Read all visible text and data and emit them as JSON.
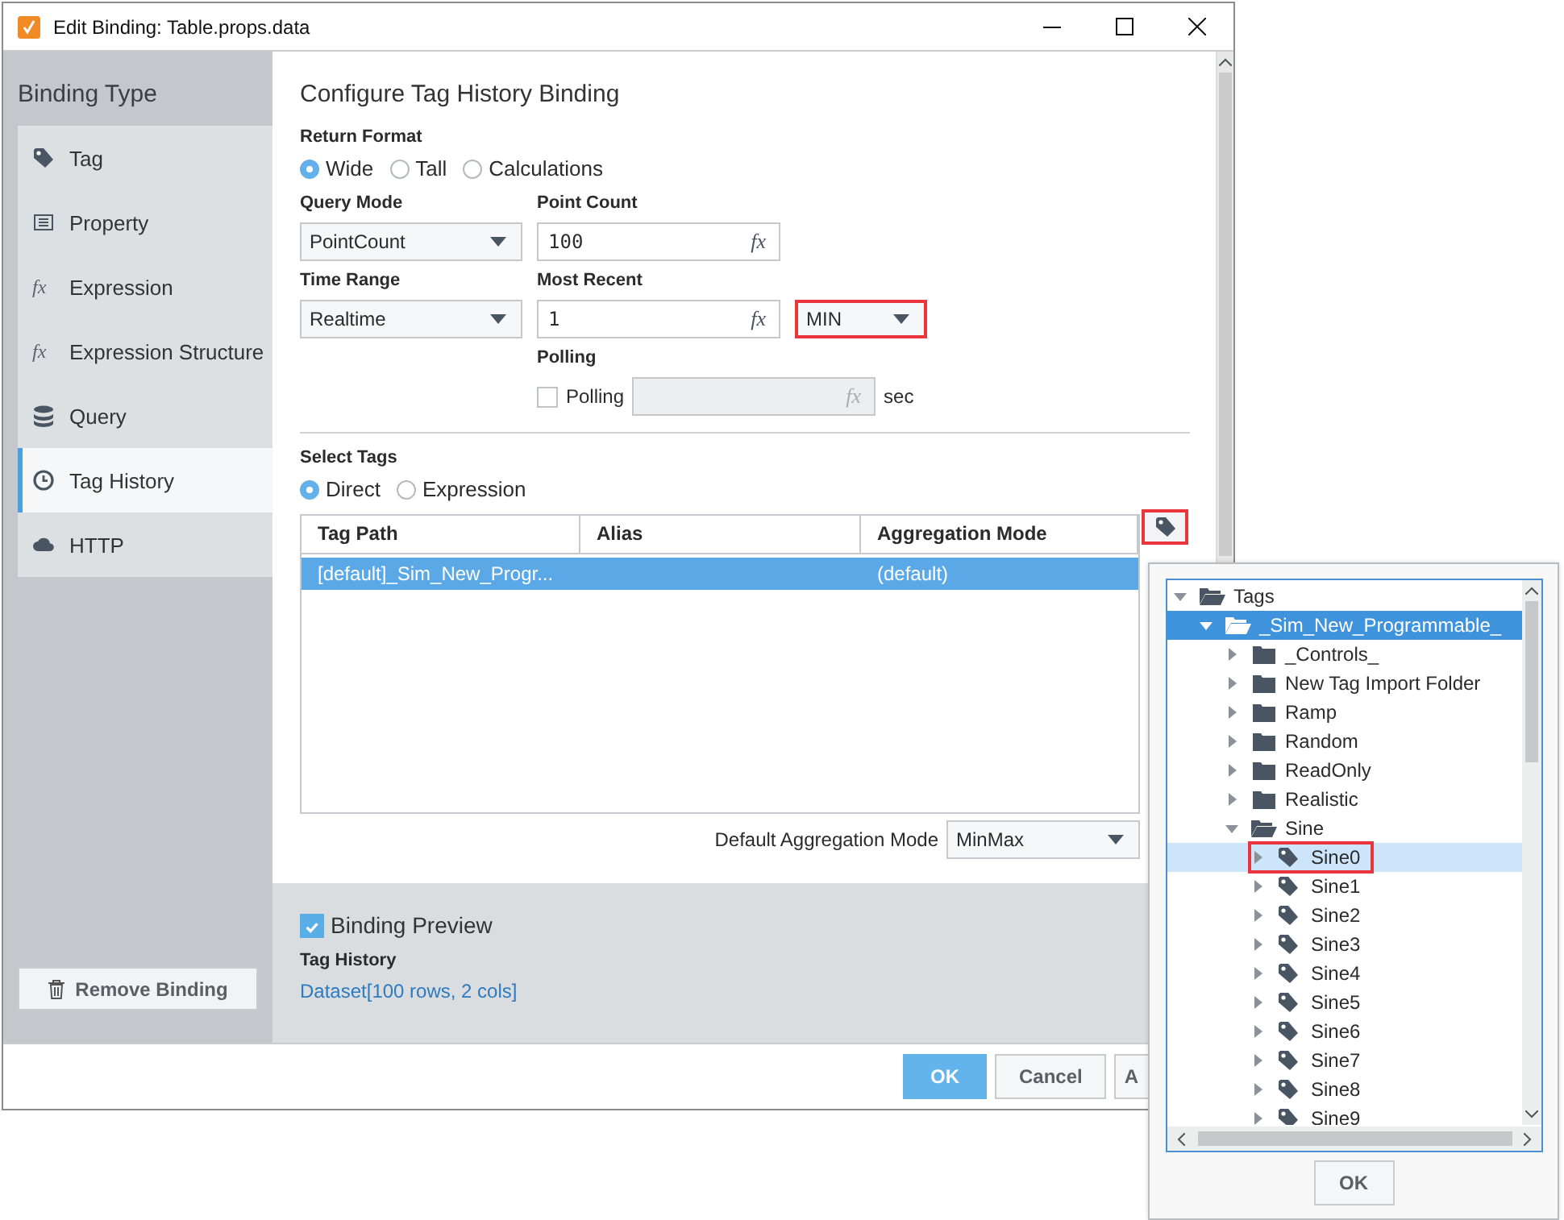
{
  "window": {
    "title": "Edit Binding: Table.props.data"
  },
  "sidebar": {
    "heading": "Binding Type",
    "items": [
      {
        "label": "Tag",
        "kind": "tag",
        "selected": false
      },
      {
        "label": "Property",
        "kind": "property",
        "selected": false
      },
      {
        "label": "Expression",
        "kind": "expression",
        "icon_text": "fx",
        "selected": false
      },
      {
        "label": "Expression Structure",
        "kind": "expression",
        "icon_text": "fx",
        "selected": false
      },
      {
        "label": "Query",
        "kind": "query",
        "selected": false
      },
      {
        "label": "Tag History",
        "kind": "history",
        "selected": true
      },
      {
        "label": "HTTP",
        "kind": "http",
        "selected": false
      }
    ],
    "remove_button": "Remove Binding"
  },
  "config": {
    "title": "Configure Tag History Binding",
    "return_format": {
      "label": "Return Format",
      "options": [
        {
          "label": "Wide",
          "selected": true
        },
        {
          "label": "Tall",
          "selected": false
        },
        {
          "label": "Calculations",
          "selected": false
        }
      ]
    },
    "query_mode": {
      "label": "Query Mode",
      "value": "PointCount"
    },
    "point_count": {
      "label": "Point Count",
      "value": "100",
      "expr": "fx"
    },
    "time_range": {
      "label": "Time Range",
      "value": "Realtime"
    },
    "most_recent": {
      "label": "Most Recent",
      "value": "1",
      "expr": "fx"
    },
    "unit": {
      "value": "MIN",
      "highlighted": true
    },
    "polling": {
      "label": "Polling",
      "checkbox_label": "Polling",
      "checked": false,
      "disabled": true,
      "expr": "fx",
      "unit": "sec"
    },
    "select_tags": {
      "label": "Select Tags",
      "options": [
        {
          "label": "Direct",
          "selected": true
        },
        {
          "label": "Expression",
          "selected": false
        }
      ],
      "browse_highlighted": true
    },
    "table": {
      "columns": [
        "Tag Path",
        "Alias",
        "Aggregation Mode"
      ],
      "rows": [
        {
          "tag_path": "[default]_Sim_New_Progr...",
          "aggregation_mode": "(default)",
          "selected": true
        }
      ]
    },
    "default_aggregation": {
      "label": "Default Aggregation Mode",
      "value": "MinMax"
    }
  },
  "preview": {
    "label": "Binding Preview",
    "checked": true,
    "type": "Tag History",
    "result": "Dataset[100 rows, 2 cols]"
  },
  "buttons": [
    {
      "label": "OK",
      "kind": "primary"
    },
    {
      "label": "Cancel",
      "kind": "default"
    },
    {
      "label": "A",
      "kind": "default"
    }
  ],
  "tag_browser": {
    "button": "OK",
    "tree": [
      {
        "label": "Tags",
        "kind": "folder",
        "expanded": true,
        "selected": false,
        "hovered": false,
        "highlighted": false,
        "children": [
          {
            "label": "_Sim_New_Programmable_",
            "kind": "folder",
            "expanded": true,
            "selected": true,
            "hovered": false,
            "highlighted": false,
            "children": [
              {
                "label": "_Controls_",
                "kind": "folder",
                "expanded": false,
                "selected": false,
                "hovered": false,
                "highlighted": false
              },
              {
                "label": "New Tag Import Folder",
                "kind": "folder",
                "expanded": false,
                "selected": false,
                "hovered": false,
                "highlighted": false
              },
              {
                "label": "Ramp",
                "kind": "folder",
                "expanded": false,
                "selected": false,
                "hovered": false,
                "highlighted": false
              },
              {
                "label": "Random",
                "kind": "folder",
                "expanded": false,
                "selected": false,
                "hovered": false,
                "highlighted": false
              },
              {
                "label": "ReadOnly",
                "kind": "folder",
                "expanded": false,
                "selected": false,
                "hovered": false,
                "highlighted": false
              },
              {
                "label": "Realistic",
                "kind": "folder",
                "expanded": false,
                "selected": false,
                "hovered": false,
                "highlighted": false
              },
              {
                "label": "Sine",
                "kind": "folder",
                "expanded": true,
                "selected": false,
                "hovered": false,
                "highlighted": false,
                "children": [
                  {
                    "label": "Sine0",
                    "kind": "tag",
                    "expanded": false,
                    "selected": false,
                    "hovered": true,
                    "highlighted": true
                  },
                  {
                    "label": "Sine1",
                    "kind": "tag",
                    "expanded": false,
                    "selected": false,
                    "hovered": false,
                    "highlighted": false
                  },
                  {
                    "label": "Sine2",
                    "kind": "tag",
                    "expanded": false,
                    "selected": false,
                    "hovered": false,
                    "highlighted": false
                  },
                  {
                    "label": "Sine3",
                    "kind": "tag",
                    "expanded": false,
                    "selected": false,
                    "hovered": false,
                    "highlighted": false
                  },
                  {
                    "label": "Sine4",
                    "kind": "tag",
                    "expanded": false,
                    "selected": false,
                    "hovered": false,
                    "highlighted": false
                  },
                  {
                    "label": "Sine5",
                    "kind": "tag",
                    "expanded": false,
                    "selected": false,
                    "hovered": false,
                    "highlighted": false
                  },
                  {
                    "label": "Sine6",
                    "kind": "tag",
                    "expanded": false,
                    "selected": false,
                    "hovered": false,
                    "highlighted": false
                  },
                  {
                    "label": "Sine7",
                    "kind": "tag",
                    "expanded": false,
                    "selected": false,
                    "hovered": false,
                    "highlighted": false
                  },
                  {
                    "label": "Sine8",
                    "kind": "tag",
                    "expanded": false,
                    "selected": false,
                    "hovered": false,
                    "highlighted": false
                  },
                  {
                    "label": "Sine9",
                    "kind": "tag",
                    "expanded": false,
                    "selected": false,
                    "hovered": false,
                    "highlighted": false
                  }
                ]
              }
            ]
          }
        ]
      }
    ]
  }
}
